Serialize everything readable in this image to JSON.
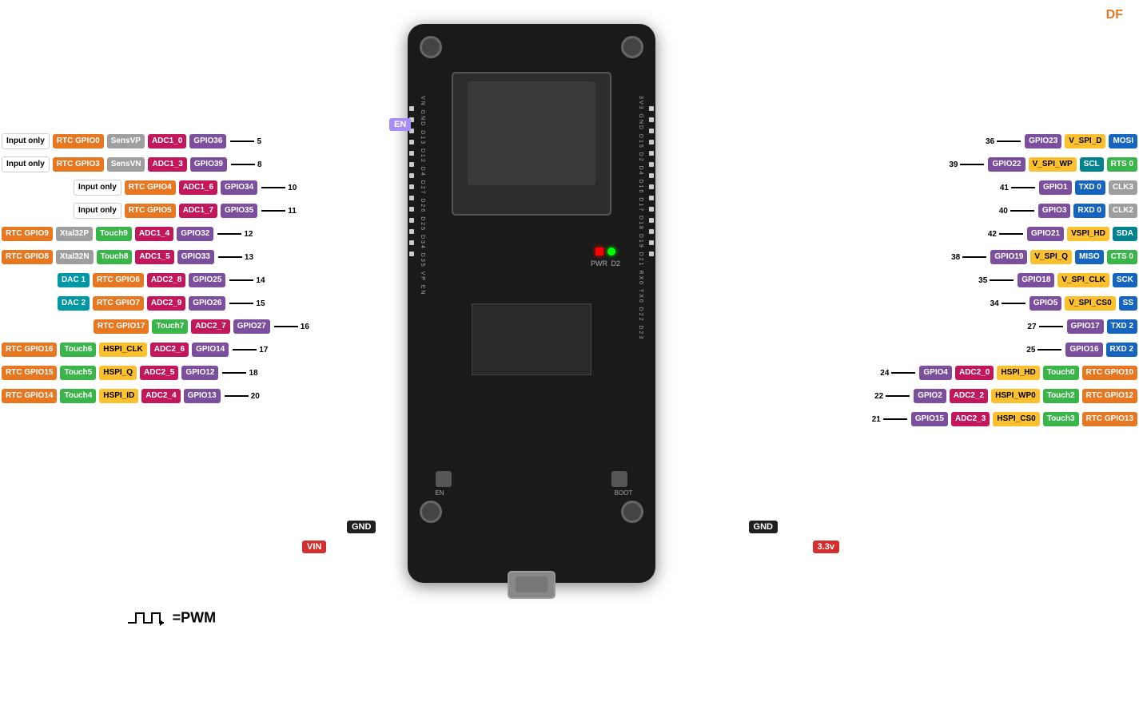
{
  "brand": "DF",
  "pwm_label": "=PWM",
  "en_label": "EN",
  "gnd_left": "GND",
  "vin_label": "VIN",
  "gnd_right": "GND",
  "v33_label": "3.3v",
  "left_pins": [
    {
      "row": 1,
      "labels": [
        {
          "text": "Input only",
          "color": "bg-white"
        },
        {
          "text": "RTC GPIO0",
          "color": "bg-orange"
        },
        {
          "text": "SensVP",
          "color": "bg-gray"
        },
        {
          "text": "ADC1_0",
          "color": "bg-magenta"
        },
        {
          "text": "GPIO36",
          "color": "bg-purple"
        },
        {
          "text": "5",
          "color": "plain"
        }
      ]
    },
    {
      "row": 2,
      "labels": [
        {
          "text": "Input only",
          "color": "bg-white"
        },
        {
          "text": "RTC GPIO3",
          "color": "bg-orange"
        },
        {
          "text": "SensVN",
          "color": "bg-gray"
        },
        {
          "text": "ADC1_3",
          "color": "bg-magenta"
        },
        {
          "text": "GPIO39",
          "color": "bg-purple"
        },
        {
          "text": "8",
          "color": "plain"
        }
      ]
    },
    {
      "row": 3,
      "labels": [
        {
          "text": "Input only",
          "color": "bg-white"
        },
        {
          "text": "RTC GPIO4",
          "color": "bg-orange"
        },
        {
          "text": "ADC1_6",
          "color": "bg-magenta"
        },
        {
          "text": "GPIO34",
          "color": "bg-purple"
        },
        {
          "text": "10",
          "color": "plain"
        }
      ]
    },
    {
      "row": 4,
      "labels": [
        {
          "text": "Input only",
          "color": "bg-white"
        },
        {
          "text": "RTC GPIO5",
          "color": "bg-orange"
        },
        {
          "text": "ADC1_7",
          "color": "bg-magenta"
        },
        {
          "text": "GPIO35",
          "color": "bg-purple"
        },
        {
          "text": "11",
          "color": "plain"
        }
      ]
    },
    {
      "row": 5,
      "labels": [
        {
          "text": "RTC GPIO9",
          "color": "bg-orange"
        },
        {
          "text": "Xtal32P",
          "color": "bg-gray"
        },
        {
          "text": "Touch9",
          "color": "bg-green"
        },
        {
          "text": "ADC1_4",
          "color": "bg-magenta"
        },
        {
          "text": "GPIO32",
          "color": "bg-purple"
        },
        {
          "text": "12",
          "color": "plain"
        }
      ]
    },
    {
      "row": 6,
      "labels": [
        {
          "text": "RTC GPIO8",
          "color": "bg-orange"
        },
        {
          "text": "Xtal32N",
          "color": "bg-gray"
        },
        {
          "text": "Touch8",
          "color": "bg-green"
        },
        {
          "text": "ADC1_5",
          "color": "bg-magenta"
        },
        {
          "text": "GPIO33",
          "color": "bg-purple"
        },
        {
          "text": "13",
          "color": "plain"
        }
      ]
    },
    {
      "row": 7,
      "labels": [
        {
          "text": "DAC 1",
          "color": "bg-cyan"
        },
        {
          "text": "RTC GPIO6",
          "color": "bg-orange"
        },
        {
          "text": "ADC2_8",
          "color": "bg-magenta"
        },
        {
          "text": "GPIO25",
          "color": "bg-purple"
        },
        {
          "text": "14",
          "color": "plain"
        }
      ]
    },
    {
      "row": 8,
      "labels": [
        {
          "text": "DAC 2",
          "color": "bg-cyan"
        },
        {
          "text": "RTC GPIO7",
          "color": "bg-orange"
        },
        {
          "text": "ADC2_9",
          "color": "bg-magenta"
        },
        {
          "text": "GPIO26",
          "color": "bg-purple"
        },
        {
          "text": "15",
          "color": "plain"
        }
      ]
    },
    {
      "row": 9,
      "labels": [
        {
          "text": "RTC GPIO17",
          "color": "bg-orange"
        },
        {
          "text": "Touch7",
          "color": "bg-green"
        },
        {
          "text": "ADC2_7",
          "color": "bg-magenta"
        },
        {
          "text": "GPIO27",
          "color": "bg-purple"
        },
        {
          "text": "16",
          "color": "plain"
        }
      ]
    },
    {
      "row": 10,
      "labels": [
        {
          "text": "RTC GPIO16",
          "color": "bg-orange"
        },
        {
          "text": "Touch6",
          "color": "bg-green"
        },
        {
          "text": "HSPI_CLK",
          "color": "bg-yellow"
        },
        {
          "text": "ADC2_6",
          "color": "bg-magenta"
        },
        {
          "text": "GPIO14",
          "color": "bg-purple"
        },
        {
          "text": "17",
          "color": "plain"
        }
      ]
    },
    {
      "row": 11,
      "labels": [
        {
          "text": "RTC GPIO15",
          "color": "bg-orange"
        },
        {
          "text": "Touch5",
          "color": "bg-green"
        },
        {
          "text": "HSPI_Q",
          "color": "bg-yellow"
        },
        {
          "text": "ADC2_5",
          "color": "bg-magenta"
        },
        {
          "text": "GPIO12",
          "color": "bg-purple"
        },
        {
          "text": "18",
          "color": "plain"
        }
      ]
    },
    {
      "row": 12,
      "labels": [
        {
          "text": "RTC GPIO14",
          "color": "bg-orange"
        },
        {
          "text": "Touch4",
          "color": "bg-green"
        },
        {
          "text": "HSPI_ID",
          "color": "bg-yellow"
        },
        {
          "text": "ADC2_4",
          "color": "bg-magenta"
        },
        {
          "text": "GPIO13",
          "color": "bg-purple"
        },
        {
          "text": "20",
          "color": "plain"
        }
      ]
    }
  ],
  "right_pins": [
    {
      "row": 1,
      "num": "36",
      "labels": [
        {
          "text": "GPIO23",
          "color": "bg-purple"
        },
        {
          "text": "V_SPI_D",
          "color": "bg-yellow"
        },
        {
          "text": "MOSI",
          "color": "bg-blue"
        }
      ]
    },
    {
      "row": 2,
      "num": "39",
      "labels": [
        {
          "text": "GPIO22",
          "color": "bg-purple"
        },
        {
          "text": "V_SPI_WP",
          "color": "bg-yellow"
        },
        {
          "text": "SCL",
          "color": "bg-teal"
        },
        {
          "text": "RTS 0",
          "color": "bg-green"
        }
      ]
    },
    {
      "row": 3,
      "num": "41",
      "labels": [
        {
          "text": "GPIO1",
          "color": "bg-purple"
        },
        {
          "text": "TXD 0",
          "color": "bg-blue"
        },
        {
          "text": "CLK3",
          "color": "bg-gray"
        }
      ]
    },
    {
      "row": 4,
      "num": "40",
      "labels": [
        {
          "text": "GPIO3",
          "color": "bg-purple"
        },
        {
          "text": "RXD 0",
          "color": "bg-blue"
        },
        {
          "text": "CLK2",
          "color": "bg-gray"
        }
      ]
    },
    {
      "row": 5,
      "num": "42",
      "labels": [
        {
          "text": "GPIO21",
          "color": "bg-purple"
        },
        {
          "text": "VSPI_HD",
          "color": "bg-yellow"
        },
        {
          "text": "SDA",
          "color": "bg-teal"
        }
      ]
    },
    {
      "row": 6,
      "num": "38",
      "labels": [
        {
          "text": "GPIO19",
          "color": "bg-purple"
        },
        {
          "text": "V_SPI_Q",
          "color": "bg-yellow"
        },
        {
          "text": "MISO",
          "color": "bg-blue"
        },
        {
          "text": "CTS 0",
          "color": "bg-green"
        }
      ]
    },
    {
      "row": 7,
      "num": "35",
      "labels": [
        {
          "text": "GPIO18",
          "color": "bg-purple"
        },
        {
          "text": "V_SPI_CLK",
          "color": "bg-yellow"
        },
        {
          "text": "SCK",
          "color": "bg-blue"
        }
      ]
    },
    {
      "row": 8,
      "num": "34",
      "labels": [
        {
          "text": "GPIO5",
          "color": "bg-purple"
        },
        {
          "text": "V_SPI_CS0",
          "color": "bg-yellow"
        },
        {
          "text": "SS",
          "color": "bg-blue"
        }
      ]
    },
    {
      "row": 9,
      "num": "27",
      "labels": [
        {
          "text": "GPIO17",
          "color": "bg-purple"
        },
        {
          "text": "TXD 2",
          "color": "bg-blue"
        }
      ]
    },
    {
      "row": 10,
      "num": "25",
      "labels": [
        {
          "text": "GPIO16",
          "color": "bg-purple"
        },
        {
          "text": "RXD 2",
          "color": "bg-blue"
        }
      ]
    },
    {
      "row": 11,
      "num": "24",
      "labels": [
        {
          "text": "GPIO4",
          "color": "bg-purple"
        },
        {
          "text": "ADC2_0",
          "color": "bg-magenta"
        },
        {
          "text": "HSPI_HD",
          "color": "bg-yellow"
        },
        {
          "text": "Touch0",
          "color": "bg-green"
        },
        {
          "text": "RTC GPIO10",
          "color": "bg-orange"
        }
      ]
    },
    {
      "row": 12,
      "num": "22",
      "labels": [
        {
          "text": "GPIO2",
          "color": "bg-purple"
        },
        {
          "text": "ADC2_2",
          "color": "bg-magenta"
        },
        {
          "text": "HSPI_WP0",
          "color": "bg-yellow"
        },
        {
          "text": "Touch2",
          "color": "bg-green"
        },
        {
          "text": "RTC GPIO12",
          "color": "bg-orange"
        }
      ]
    },
    {
      "row": 13,
      "num": "21",
      "labels": [
        {
          "text": "GPIO15",
          "color": "bg-purple"
        },
        {
          "text": "ADC2_3",
          "color": "bg-magenta"
        },
        {
          "text": "HSPI_CS0",
          "color": "bg-yellow"
        },
        {
          "text": "Touch3",
          "color": "bg-green"
        },
        {
          "text": "RTC GPIO13",
          "color": "bg-orange"
        }
      ]
    }
  ]
}
